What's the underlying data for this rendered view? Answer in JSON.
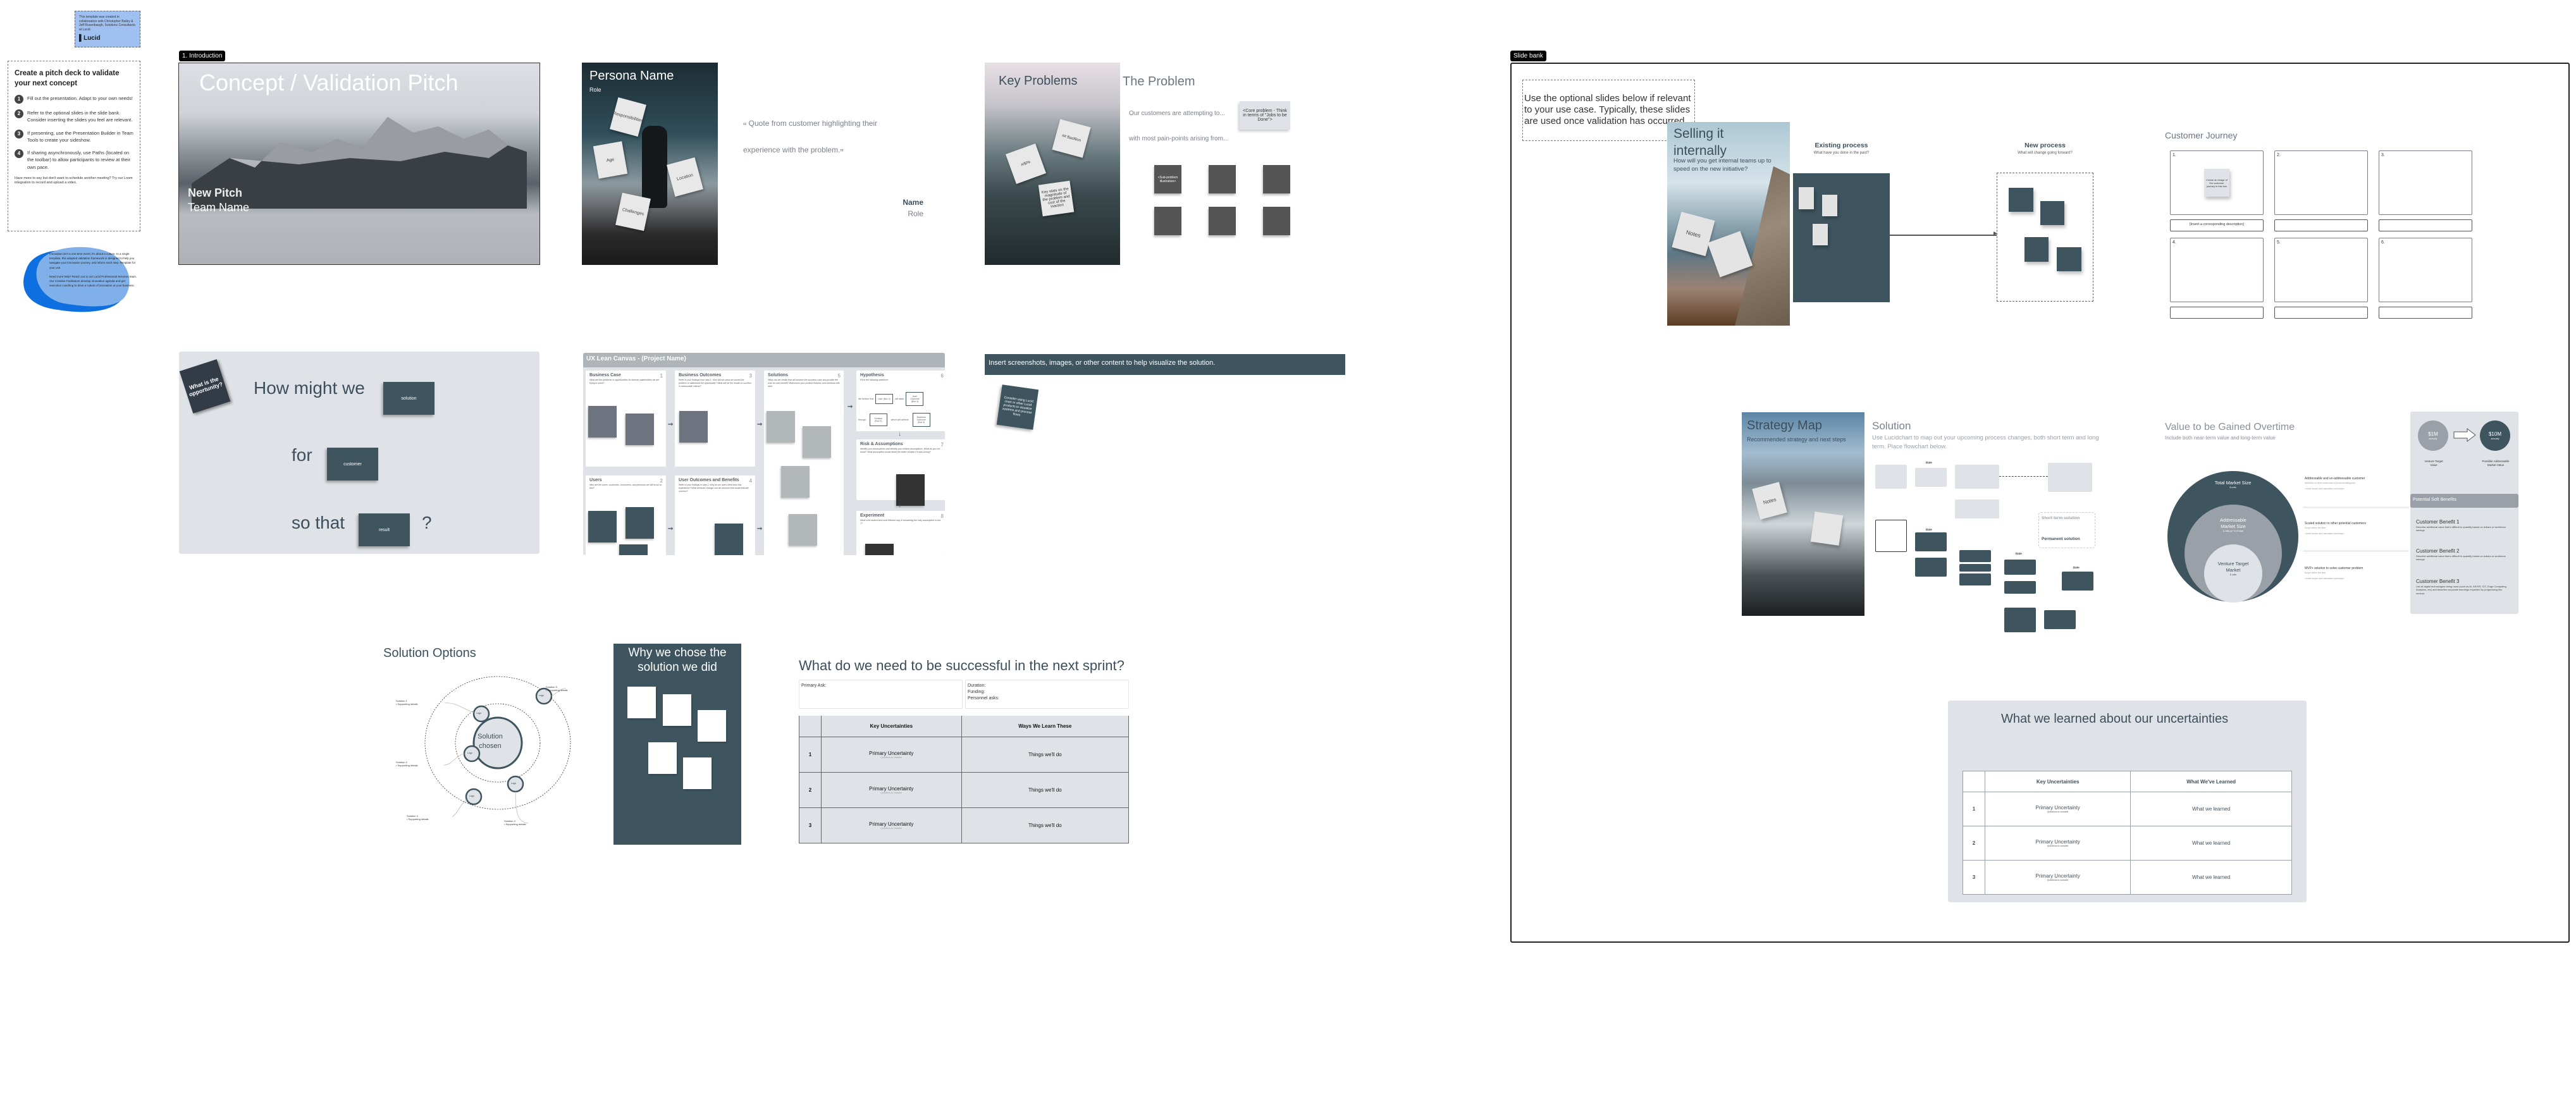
{
  "intro_note": {
    "text": "This template was created in collaboration with Christopher Bailey & Jeff Rosenbaugh, Solutions Consultants at Lucid.",
    "logo": "Lucid"
  },
  "instructions": {
    "title": "Create a pitch deck to validate your next concept",
    "steps": [
      {
        "num": "1",
        "text": "Fill out the presentation. Adapt to your own needs!"
      },
      {
        "num": "2",
        "text": "Refer to the optional slides in the slide bank. Consider inserting the slides you feel are relevant."
      },
      {
        "num": "3",
        "text": "If presenting, use the Presentation Builder in Team Tools to create your sideshow."
      },
      {
        "num": "4",
        "text": "If sharing asynchronously, use Paths (located on the toolbar) to allow participants to review at their own pace."
      }
    ],
    "footer": "Have more to say but don't want to schedule another meeting? Try our Loom integration to record and upload a video."
  },
  "blob_note": {
    "p1": "Innovation isn't a one-time event; it's about a culture. In a single template, this adapted validation framework is designed to help you navigate your innovation journey, and inform each step. Template for your use.",
    "p2": "Need more help? Reach out to our Lucid Professional Services team. Our Creative Facilitators develop innovation agenda and get executive coaching to drive a culture of innovation at your business."
  },
  "frames": {
    "intro_label": "1. Introduction",
    "bank_label": "Slide bank"
  },
  "title_slide": {
    "title": "Concept / Validation Pitch",
    "line1": "New Pitch",
    "line2": "Team Name"
  },
  "persona": {
    "name": "Persona Name",
    "role": "Role",
    "notes": [
      "Responsibilities",
      "Age",
      "Location",
      "Challenges"
    ]
  },
  "quote": {
    "open": "“",
    "close": "”",
    "text_line1": "Quote from customer highlighting their",
    "text_line2": "experience with the problem.",
    "name": "Name",
    "role": "Role"
  },
  "key_problems": {
    "title": "Key Problems",
    "notes": [
      "#/$/%",
      "## Bazillion",
      "Key stats on the magnitude of the problem and cost of the inaction"
    ]
  },
  "problem": {
    "title": "The Problem",
    "line1": "Our customers are attempting to...",
    "line2": "with most pain-points arising from...",
    "core": "<Core problem - Think in terms of \"Jobs to be Done\">",
    "sub_first": "<Sub-problem illustration>"
  },
  "hmw": {
    "tag": "What is the opportunity?",
    "line1": "How might we",
    "box1": "solution",
    "line2": "for",
    "box2": "customer",
    "line3": "so that",
    "box3": "result",
    "qmark": "?"
  },
  "lean_canvas": {
    "title": "UX Lean Canvas - (Project Name)",
    "cells": [
      {
        "num": "1",
        "title": "Business Case",
        "desc": "What are the problems or opportunities for internal stakeholders we are trying to solve?"
      },
      {
        "num": "2",
        "title": "Users",
        "desc": "Who are the users, customers, consumers, and personas we will focus on first?"
      },
      {
        "num": "3",
        "title": "Business Outcomes",
        "desc": "Refer to your findings from step 1. How will we know we solved the problem or addressed the opportunity? What will be the results or success in measurable criteria?"
      },
      {
        "num": "4",
        "title": "User Outcomes and Benefits",
        "desc": "Refer to your findings in step 2. Why do we users need from this experience? What behavior change can we observe that would indicate success?"
      },
      {
        "num": "5",
        "title": "Solutions",
        "desc": "What can we create that will achieve the business case and provide the user an user benefit? Brainstorm your product features and solutions with here."
      },
      {
        "num": "6",
        "title": "Hypothesis",
        "desc": "Fill in the following sentence:"
      },
      {
        "num": "7",
        "title": "Risk & Assumptions",
        "desc": "Identify your assumptions and identify your riskiest assumptions. What do you not know? What assumption would derail the entire solution if it was wrong?"
      },
      {
        "num": "8",
        "title": "Experiment",
        "desc": "What's the fastest and most efficient way of answering the risky assumption in box 7?"
      }
    ],
    "hypothesis": {
      "w1": "We believe that",
      "b1": "User (Box 2)",
      "w2": "will attain",
      "b2": "User Outcome (Box 4)",
      "w3": "through",
      "b3": "Solution (Box 5)",
      "w4": "which will achieve",
      "b4": "Business Outcome (Box 3)"
    }
  },
  "visualize": {
    "bar": "Insert screenshots, images, or other content to help visualize the solution.",
    "note": "Consider using Lucid chart or other Lucid products to visualize systems and process flows"
  },
  "solution_options": {
    "title": "Solution Options",
    "center": "Solution chosen",
    "logo": "Logo",
    "labels": [
      {
        "name": "Solution 1",
        "detail": "• Supporting details"
      },
      {
        "name": "Solution 2",
        "detail": "• Supporting details"
      },
      {
        "name": "Solution 3",
        "detail": "• Supporting details"
      },
      {
        "name": "Solution 4",
        "detail": "• Supporting details"
      },
      {
        "name": "Solution 5",
        "detail": "• Supporting details"
      }
    ]
  },
  "why": {
    "title": "Why we chose the solution we did"
  },
  "sprint": {
    "title": "What do we need to be successful in the next sprint?",
    "primary_ask": "Primary Ask:",
    "details": [
      "Duration:",
      "Funding:",
      "Personnel asks:"
    ],
    "headers": [
      "",
      "Key Uncertainties",
      "Ways We Learn These"
    ],
    "rows": [
      {
        "num": "1",
        "uncertainty": "Primary Uncertainty",
        "questions": "Questions to consider",
        "action": "Things we'll do"
      },
      {
        "num": "2",
        "uncertainty": "Primary Uncertainty",
        "questions": "Questions to consider",
        "action": "Things we'll do"
      },
      {
        "num": "3",
        "uncertainty": "Primary Uncertainty",
        "questions": "Questions to consider",
        "action": "Things we'll do"
      }
    ]
  },
  "bank_note": "Use the optional slides below if relevant to your use case. Typically, these slides are used once validation has occurred.",
  "selling": {
    "title": "Selling it internally",
    "desc": "How will you get internal teams up to speed on the new initiative?",
    "note": "Notes"
  },
  "process": {
    "existing_title": "Existing process",
    "existing_sub": "What have you done in the past?",
    "new_title": "New process",
    "new_sub": "What will change going forward?"
  },
  "journey": {
    "title": "Customer Journey",
    "steps": [
      "1.",
      "2.",
      "3.",
      "4.",
      "5.",
      "6."
    ],
    "note": "Create an image of the customer journey in this box",
    "desc": "[Insert a corresponding description]"
  },
  "strategy": {
    "title": "Strategy Map",
    "desc": "Recommended strategy and next steps",
    "note": "Notes"
  },
  "solution_flow": {
    "title": "Solution",
    "desc": "Use Lucidchart to map out your upcoming process changes, both short term and long term. Place flowchart below.",
    "date": "Date",
    "legend_short": "Short-term solution",
    "legend_perm": "Permanent solution"
  },
  "value": {
    "title": "Value to be Gained Overtime",
    "subtitle": "Include both near-term value and long-term value",
    "circles": [
      {
        "label": "Total Market Size",
        "value": "$ units"
      },
      {
        "label": "Addressable Market Size",
        "value": "$ units (or % of total)"
      },
      {
        "label": "Venture Target Market",
        "value": "$ units"
      }
    ],
    "rows": [
      {
        "title": "Addressable and un-addressable customer",
        "sub": "Definition of other needs/use of products/categories",
        "calc": "<Insert scope and calculation summary>"
      },
      {
        "title": "Scaled solution to other potential customers",
        "sub": "Scope within the time",
        "calc": "<Insert scope and calculation summary>"
      },
      {
        "title": "MVP+ solution to solve customer problem",
        "sub": "Scope within the time",
        "calc": "<Insert scope and calculation summary>"
      }
    ],
    "from_amount": "$1M",
    "from_unit": "annually",
    "from_label": "Venture Target Value",
    "to_amount": "$10M",
    "to_unit": "annually",
    "to_label": "Possible Addressable Market Value",
    "soft_title": "Potential Soft Benefits",
    "benefits": [
      {
        "title": "Customer Benefit 1",
        "desc": "Describe additional value that's difficult to quantify based on dollars or workforce savings"
      },
      {
        "title": "Customer Benefit 2",
        "desc": "Describe additional value that's difficult to quantify based on dollars or workforce savings"
      },
      {
        "title": "Customer Benefit 3",
        "desc": "List all digital technologies being used (such as AI, AR/VR, IOT, Edge Computing, Analytics, etc) and describe corporate learnings expected by progressing this venture."
      }
    ]
  },
  "learned": {
    "title": "What we learned about our uncertainties",
    "headers": [
      "",
      "Key Uncertainties",
      "What We've Learned"
    ],
    "rows": [
      {
        "num": "1",
        "uncertainty": "Primary Uncertainty",
        "questions": "Questions to consider",
        "learned": "What we learned"
      },
      {
        "num": "2",
        "uncertainty": "Primary Uncertainty",
        "questions": "Questions to consider",
        "learned": "What we learned"
      },
      {
        "num": "3",
        "uncertainty": "Primary Uncertainty",
        "questions": "Questions to consider",
        "learned": "What we learned"
      }
    ]
  },
  "colors": {
    "accent_dark": "#3e5560",
    "panel_gray": "#dfe2e6",
    "blob_light": "#7fb0ea",
    "blob_dark": "#0e6fe0"
  }
}
